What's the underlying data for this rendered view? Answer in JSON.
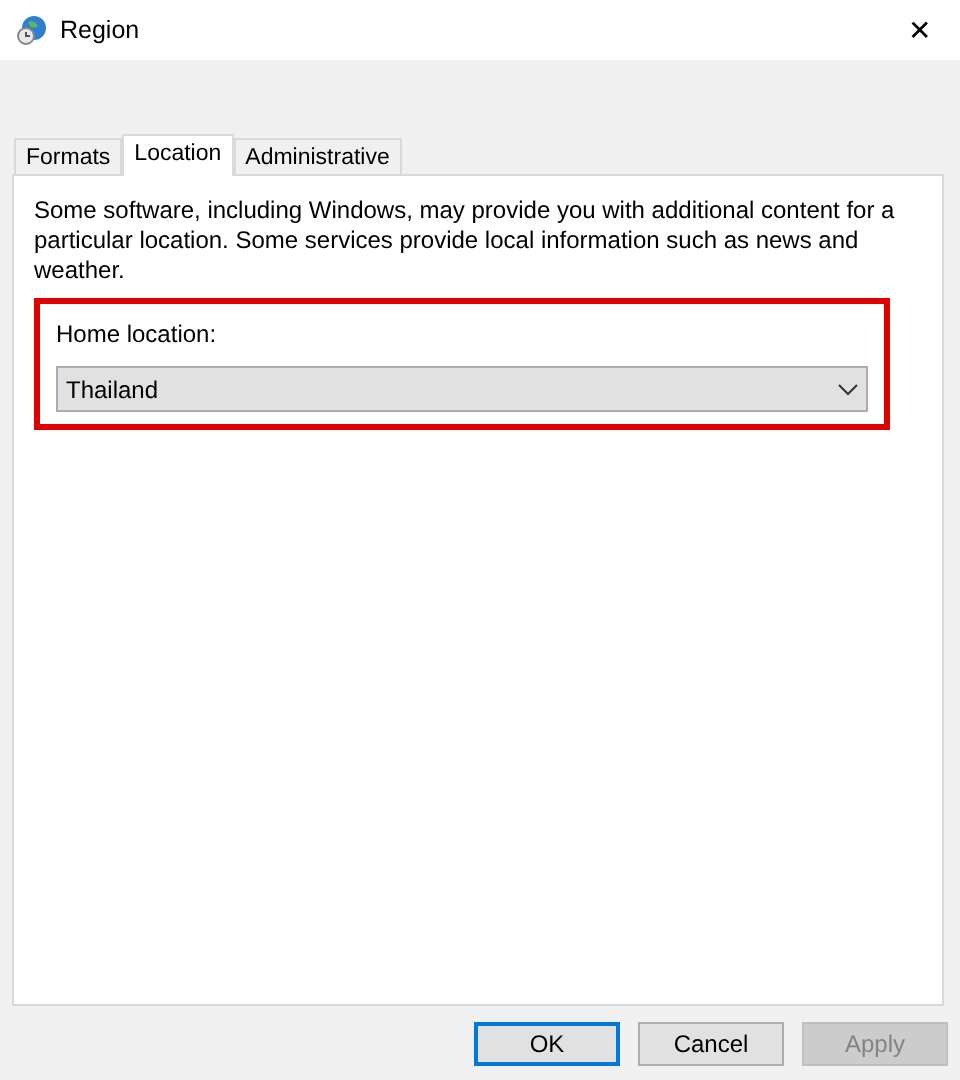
{
  "window": {
    "title": "Region",
    "close": "✕"
  },
  "tabs": [
    {
      "label": "Formats",
      "selected": false
    },
    {
      "label": "Location",
      "selected": true
    },
    {
      "label": "Administrative",
      "selected": false
    }
  ],
  "description": "Some software, including Windows, may provide you with additional content for a particular location. Some services provide local information such as news and weather.",
  "home_location": {
    "label": "Home location:",
    "value": "Thailand"
  },
  "buttons": [
    {
      "label": "OK",
      "default": true,
      "disabled": false
    },
    {
      "label": "Cancel",
      "default": false,
      "disabled": false
    },
    {
      "label": "Apply",
      "default": false,
      "disabled": true
    }
  ]
}
